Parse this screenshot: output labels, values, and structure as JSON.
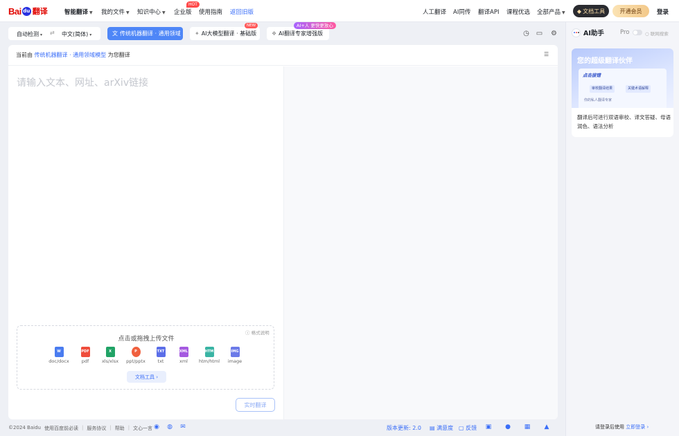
{
  "colors": {
    "accent": "#3a6ef8",
    "active_mode": "#4e86f7",
    "brand_red": "#e10601",
    "hot": "#ff4a4a"
  },
  "header": {
    "logo_bai": "Bai",
    "logo_du": "du",
    "logo_fanyi": "翻译",
    "nav": [
      {
        "label": "智能翻译",
        "caret": true
      },
      {
        "label": "我的文件",
        "caret": true
      },
      {
        "label": "知识中心",
        "caret": true
      },
      {
        "label": "企业版",
        "badge": "HOT"
      },
      {
        "label": "使用指南"
      },
      {
        "label": "返回旧版"
      }
    ],
    "right_nav": [
      "人工翻译",
      "AI同传",
      "翻译API",
      "课程优选",
      "全部产品"
    ],
    "doc_tool_label": "文档工具",
    "vip_label": "开通会员",
    "login_label": "登录"
  },
  "toolbar": {
    "source_lang": "自动检测",
    "swap_icon": "swap-icon",
    "target_lang": "中文(简体)",
    "modes": [
      {
        "label": "传统机器翻译 · 通用领域",
        "active": true
      },
      {
        "label": "AI大模型翻译 · 基础版",
        "badge": "NEW"
      },
      {
        "label": "AI翻译专家增强版",
        "badge": "AI+人 更快更放心"
      }
    ],
    "icons": [
      "history-icon",
      "folder-icon",
      "settings-icon"
    ]
  },
  "panel": {
    "hint_prefix": "当前由",
    "hint_engine": "传统机器翻译 · 通用领域模型",
    "hint_suffix": "为您翻译",
    "placeholder": "请输入文本、网址、arXiv链接",
    "upload_title": "点击或拖拽上传文件",
    "format_note": "ⓘ 格式说明",
    "files": [
      {
        "label": "doc/docx",
        "icon": "word-icon",
        "color": "#4a7cf0",
        "glyph": "W"
      },
      {
        "label": "pdf",
        "icon": "pdf-icon",
        "color": "#ef4d3c",
        "glyph": "PDF"
      },
      {
        "label": "xls/xlsx",
        "icon": "excel-icon",
        "color": "#21a366",
        "glyph": "X"
      },
      {
        "label": "ppt/pptx",
        "icon": "ppt-icon",
        "color": "#f0603e",
        "glyph": "P"
      },
      {
        "label": "txt",
        "icon": "txt-icon",
        "color": "#5b6ee8",
        "glyph": "TXT"
      },
      {
        "label": "xml",
        "icon": "xml-icon",
        "color": "#a55ae0",
        "glyph": "XML"
      },
      {
        "label": "htm/html",
        "icon": "html-icon",
        "color": "#3ab4a4",
        "glyph": "HTM"
      },
      {
        "label": "image",
        "icon": "image-icon",
        "color": "#6b7ae8",
        "glyph": "IMG"
      }
    ],
    "doc_tool_button": "文档工具 ›",
    "translate_button": "实时翻译"
  },
  "footer": {
    "links": [
      "©2024 Baidu",
      "使用百度前必读",
      "服务协议",
      "帮助",
      "文心一言"
    ],
    "social_icons": [
      "weibo-icon",
      "wechat-icon",
      "mail-icon"
    ],
    "version": "版本更新: 2.0",
    "satisfaction": "满意度",
    "feedback": "反馈",
    "platform_icons": [
      "android-icon",
      "apple-icon",
      "windows-icon",
      "appstore-icon"
    ]
  },
  "sidebar": {
    "title": "AI助手",
    "pro_label": "Pro",
    "net_search": "联网搜索",
    "promo_title": "您的超级翻译伙伴",
    "promo_click": "点击拔错",
    "promo_chip1": "审校翻译结果",
    "promo_chip2": "关键术语解释",
    "promo_line": "你的私人翻译专家",
    "promo_desc": "翻译后可进行双语审校、译文答疑、母语润色、语法分析",
    "login_hint": "请登录后使用",
    "login_link": "立即登录 ›"
  }
}
